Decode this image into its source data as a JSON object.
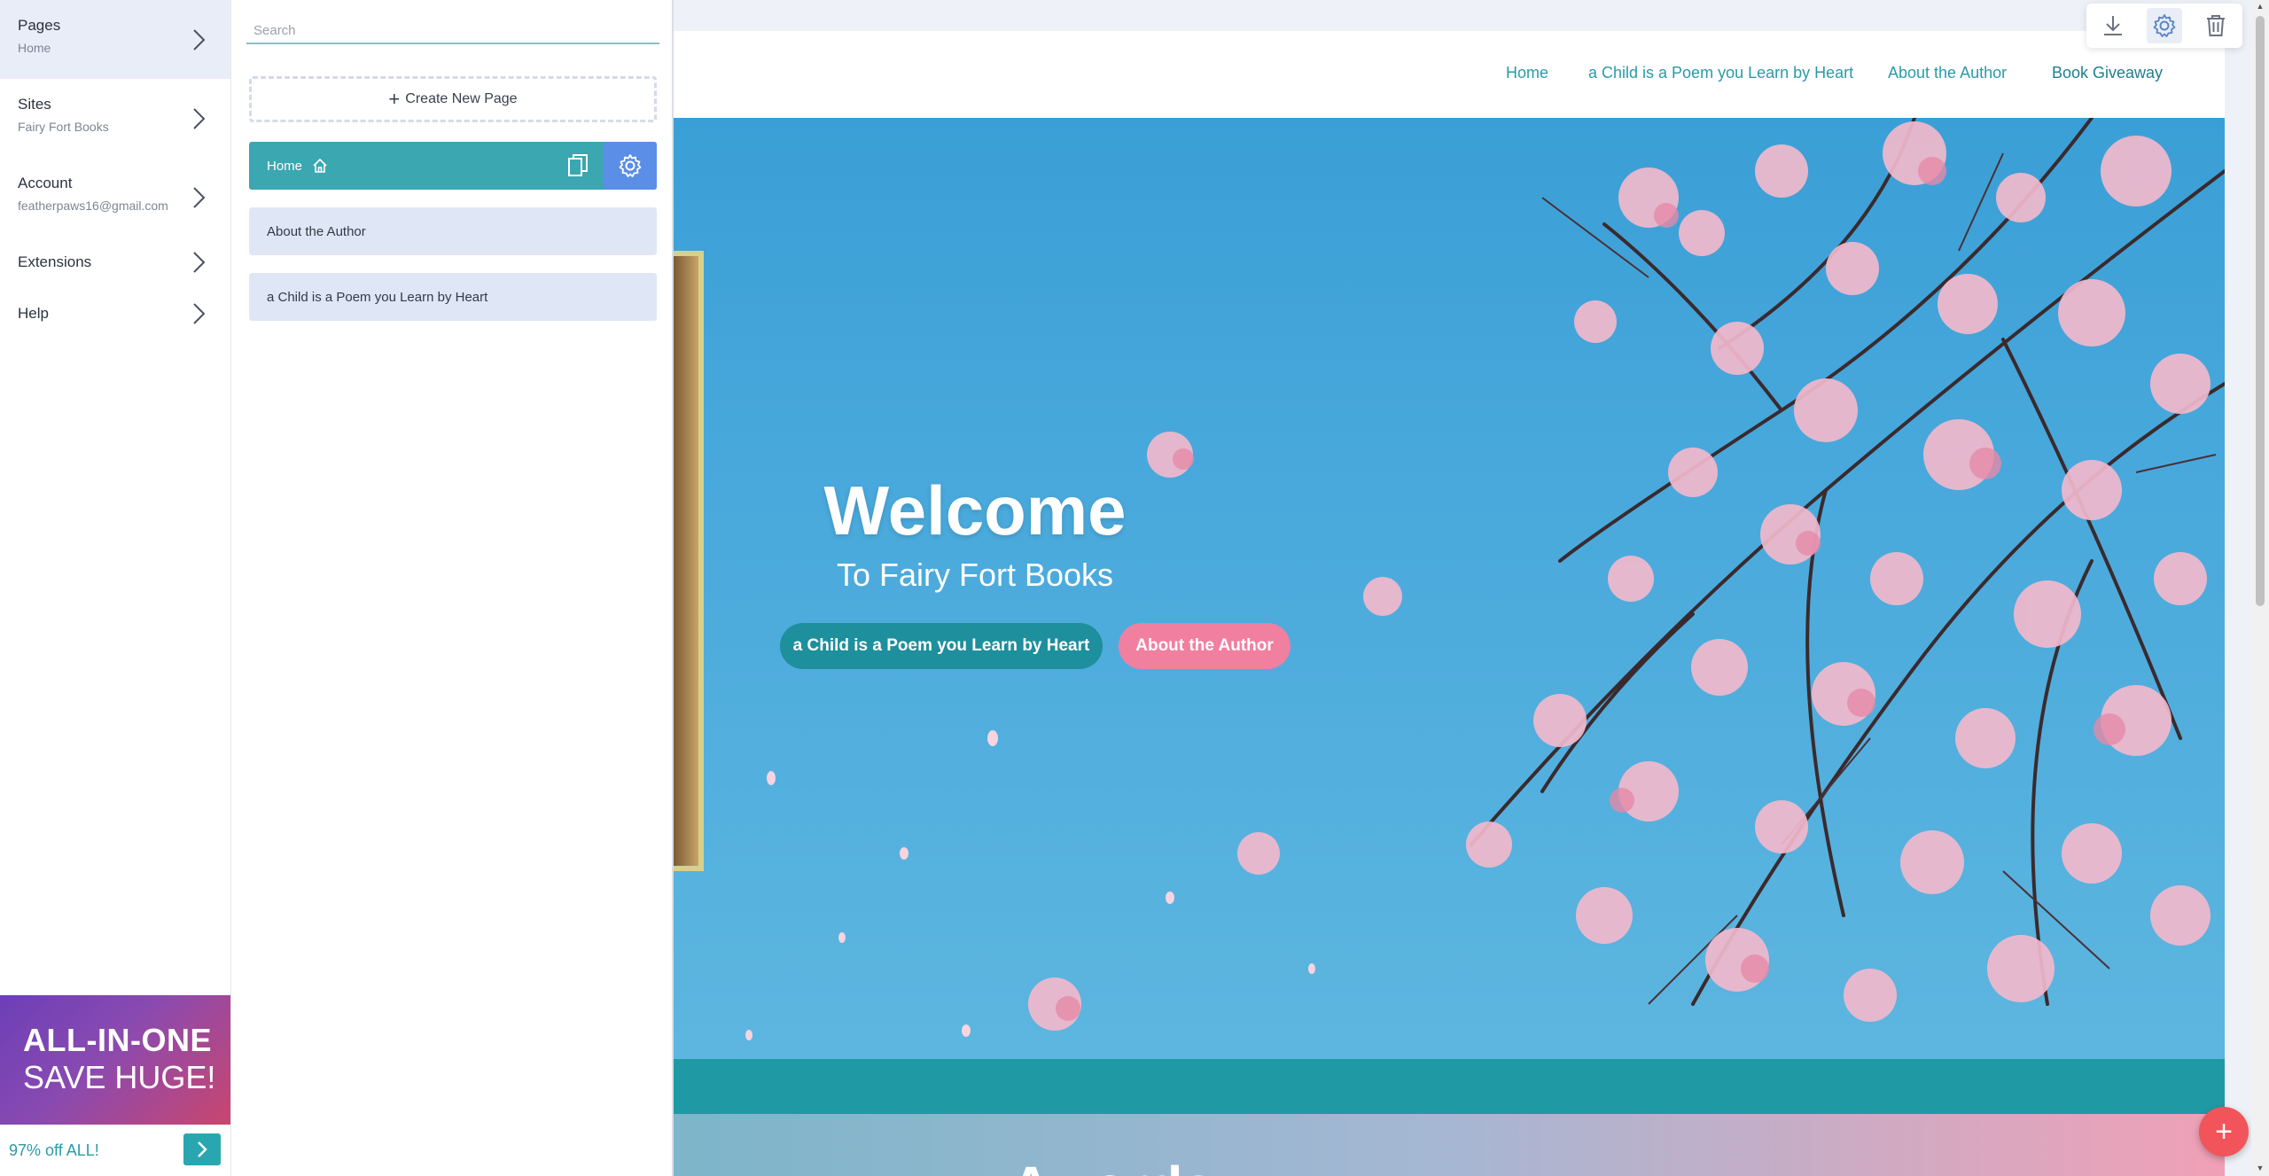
{
  "sidebar": {
    "items": [
      {
        "title": "Pages",
        "subtitle": "Home"
      },
      {
        "title": "Sites",
        "subtitle": "Fairy Fort Books"
      },
      {
        "title": "Account",
        "subtitle": "featherpaws16@gmail.com"
      },
      {
        "title": "Extensions",
        "subtitle": ""
      },
      {
        "title": "Help",
        "subtitle": ""
      }
    ],
    "promo": {
      "line1": "ALL-IN-ONE",
      "line2": "SAVE HUGE!",
      "footer": "97% off ALL!"
    }
  },
  "pages_panel": {
    "search_placeholder": "Search",
    "create_label": "Create New Page",
    "pages": [
      {
        "label": "Home"
      },
      {
        "label": "About the Author"
      },
      {
        "label": "a Child is a Poem you Learn by Heart"
      }
    ]
  },
  "site": {
    "nav": [
      "Home",
      "a Child is a Poem you Learn by Heart",
      "About the Author",
      "Book Giveaway"
    ],
    "hero_title": "Welcome",
    "hero_subtitle": "To Fairy Fort Books",
    "hero_button_primary": "a Child is a Poem you Learn by Heart",
    "hero_button_secondary": "About the Author",
    "section_title": "Awards"
  },
  "colors": {
    "accent": "#2aa6b0",
    "active_gear": "#5b8ee6",
    "pink": "#f17fa0",
    "fab": "#f2545b"
  },
  "icons": [
    "chevron-right-icon",
    "plus-icon",
    "home-icon",
    "copy-icon",
    "gear-icon",
    "download-icon",
    "trash-icon"
  ]
}
